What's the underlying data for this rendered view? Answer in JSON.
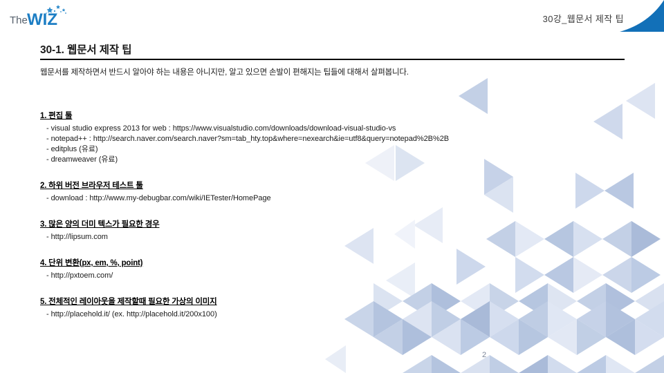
{
  "slide": {
    "page_number": "2",
    "accent_color": "#1270b8",
    "rule_color": "#000000",
    "deco_colors": [
      "#eef2f8",
      "#dfe6f2",
      "#c8d4e8",
      "#aabbd9",
      "#93a9cd"
    ]
  },
  "logo": {
    "the_text": "The",
    "wiz_text": "WIZ",
    "sparkle_icon": "sparkle-stars-icon",
    "the_color": "#555f6b",
    "wiz_color": "#1d7ec4"
  },
  "header": {
    "title": "30강_웹문서 제작 팁"
  },
  "title_block": {
    "page_title": "30-1. 웹문서 제작 팁",
    "subtitle": "웹문서를 제작하면서 반드시 알아야 하는 내용은 아니지만, 알고 있으면 손발이 편해지는 팁들에 대해서 살펴봅니다."
  },
  "sections": [
    {
      "heading": "1. 편집 툴",
      "lines": [
        "- visual studio express 2013 for web : https://www.visualstudio.com/downloads/download-visual-studio-vs",
        "- notepad++ : http://search.naver.com/search.naver?sm=tab_hty.top&where=nexearch&ie=utf8&query=notepad%2B%2B",
        "- editplus (유료)",
        "- dreamweaver (유료)"
      ]
    },
    {
      "heading": "2. 하위 버전 브라우저 테스트 툴",
      "lines": [
        "- download : http://www.my-debugbar.com/wiki/IETester/HomePage"
      ]
    },
    {
      "heading": "3. 많은 양의 더미 텍스가 필요한 경우",
      "lines": [
        "- http://lipsum.com"
      ]
    },
    {
      "heading": "4. 단위 변환(px, em, %, point)",
      "lines": [
        "- http://pxtoem.com/"
      ]
    },
    {
      "heading": "5. 전체적인 레이아웃을 제작할때 필요한 가상의 이미지",
      "lines": [
        "- http://placehold.it/ (ex. http://placehold.it/200x100)"
      ]
    }
  ]
}
